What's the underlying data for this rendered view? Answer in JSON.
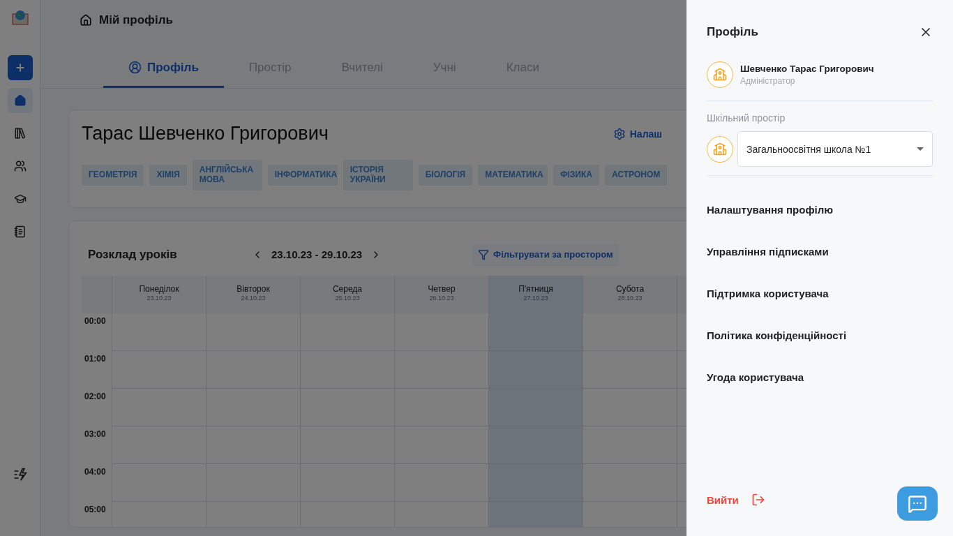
{
  "header": {
    "title": "Мій профіль"
  },
  "sidebar": {
    "items": [
      {
        "selected": true
      },
      {
        "selected": false
      },
      {
        "selected": false
      },
      {
        "selected": false
      },
      {
        "selected": false
      }
    ]
  },
  "tabs": [
    {
      "label": "Профіль",
      "selected": true
    },
    {
      "label": "Простір",
      "selected": false
    },
    {
      "label": "Вчителі",
      "selected": false
    },
    {
      "label": "Учні",
      "selected": false
    },
    {
      "label": "Класи",
      "selected": false
    }
  ],
  "profile_card": {
    "name": "Тарас Шевченко Григорович",
    "settings_button": "Налаш",
    "subjects": [
      "ГЕОМЕТРІЯ",
      "ХІМІЯ",
      "АНГЛІЙСЬКА МОВА",
      "ІНФОРМАТИКА",
      "ІСТОРІЯ УКРАЇНИ",
      "БІОЛОГІЯ",
      "МАТЕМАТИКА",
      "ФІЗИКА",
      "АСТРОНОМ"
    ]
  },
  "schedule": {
    "title": "Розклад уроків",
    "date_range": "23.10.23 - 29.10.23",
    "filter_button": "Фільтрувати за простором",
    "days": [
      {
        "name": "Понеділок",
        "date": "23.10.23",
        "selected": false
      },
      {
        "name": "Вівторок",
        "date": "24.10.23",
        "selected": false
      },
      {
        "name": "Середа",
        "date": "25.10.23",
        "selected": false
      },
      {
        "name": "Четвер",
        "date": "26.10.23",
        "selected": false
      },
      {
        "name": "П'ятниця",
        "date": "27.10.23",
        "selected": true
      },
      {
        "name": "Субота",
        "date": "28.10.23",
        "selected": false
      }
    ],
    "times": [
      "00:00",
      "01:00",
      "02:00",
      "03:00",
      "04:00",
      "05:00"
    ]
  },
  "drawer": {
    "title": "Профіль",
    "user": {
      "name": "Шевченко Тарас Григорович",
      "role": "Адміністратор"
    },
    "space_label": "Шкільний простір",
    "space_value": "Загальноосвітня школа №1",
    "menu": [
      "Налаштування профілю",
      "Управління підписками",
      "Підтримка користувача",
      "Політика конфіденційності",
      "Угода користувача"
    ],
    "logout": "Вийти"
  }
}
